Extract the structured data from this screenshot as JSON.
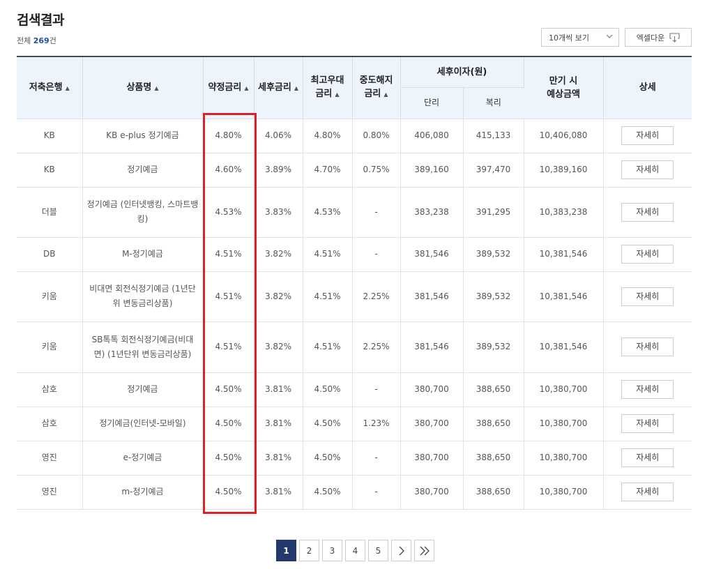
{
  "header": {
    "title": "검색결과",
    "total_prefix": "전체",
    "total_count": "269",
    "total_suffix": "건"
  },
  "toolbar": {
    "per_page_label": "10개씩 보기",
    "excel_label": "엑셀다운"
  },
  "table": {
    "headers": {
      "bank": "저축은행",
      "product": "상품명",
      "rate": "약정금리",
      "after_tax_rate": "세후금리",
      "max_rate_line1": "최고우대",
      "max_rate_line2": "금리",
      "early_rate_line1": "중도해지",
      "early_rate_line2": "금리",
      "interest_group": "세후이자(원)",
      "simple": "단리",
      "compound": "복리",
      "maturity_line1": "만기 시",
      "maturity_line2": "예상금액",
      "detail": "상세"
    },
    "sort_icon": "▲",
    "detail_label": "자세히",
    "rows": [
      {
        "bank": "KB",
        "product": "KB e-plus 정기예금",
        "rate": "4.80%",
        "after_tax": "4.06%",
        "max": "4.80%",
        "early": "0.80%",
        "simple": "406,080",
        "compound": "415,133",
        "maturity": "10,406,080"
      },
      {
        "bank": "KB",
        "product": "정기예금",
        "rate": "4.60%",
        "after_tax": "3.89%",
        "max": "4.70%",
        "early": "0.75%",
        "simple": "389,160",
        "compound": "397,470",
        "maturity": "10,389,160"
      },
      {
        "bank": "더블",
        "product": "정기예금 (인터넷뱅킹, 스마트뱅킹)",
        "rate": "4.53%",
        "after_tax": "3.83%",
        "max": "4.53%",
        "early": "-",
        "simple": "383,238",
        "compound": "391,295",
        "maturity": "10,383,238"
      },
      {
        "bank": "DB",
        "product": "M-정기예금",
        "rate": "4.51%",
        "after_tax": "3.82%",
        "max": "4.51%",
        "early": "-",
        "simple": "381,546",
        "compound": "389,532",
        "maturity": "10,381,546"
      },
      {
        "bank": "키움",
        "product": "비대면 회전식정기예금 (1년단위 변동금리상품)",
        "rate": "4.51%",
        "after_tax": "3.82%",
        "max": "4.51%",
        "early": "2.25%",
        "simple": "381,546",
        "compound": "389,532",
        "maturity": "10,381,546"
      },
      {
        "bank": "키움",
        "product": "SB톡톡 회전식정기예금(비대면) (1년단위 변동금리상품)",
        "rate": "4.51%",
        "after_tax": "3.82%",
        "max": "4.51%",
        "early": "2.25%",
        "simple": "381,546",
        "compound": "389,532",
        "maturity": "10,381,546"
      },
      {
        "bank": "삼호",
        "product": "정기예금",
        "rate": "4.50%",
        "after_tax": "3.81%",
        "max": "4.50%",
        "early": "-",
        "simple": "380,700",
        "compound": "388,650",
        "maturity": "10,380,700"
      },
      {
        "bank": "삼호",
        "product": "정기예금(인터넷-모바일)",
        "rate": "4.50%",
        "after_tax": "3.81%",
        "max": "4.50%",
        "early": "1.23%",
        "simple": "380,700",
        "compound": "388,650",
        "maturity": "10,380,700"
      },
      {
        "bank": "영진",
        "product": "e-정기예금",
        "rate": "4.50%",
        "after_tax": "3.81%",
        "max": "4.50%",
        "early": "-",
        "simple": "380,700",
        "compound": "388,650",
        "maturity": "10,380,700"
      },
      {
        "bank": "영진",
        "product": "m-정기예금",
        "rate": "4.50%",
        "after_tax": "3.81%",
        "max": "4.50%",
        "early": "-",
        "simple": "380,700",
        "compound": "388,650",
        "maturity": "10,380,700"
      }
    ]
  },
  "pagination": {
    "pages": [
      "1",
      "2",
      "3",
      "4",
      "5"
    ],
    "active": "1",
    "next_icon": "chevron-right-icon",
    "last_icon": "double-chevron-right-icon"
  },
  "colors": {
    "highlight": "#e01f26",
    "active_page": "#24396b",
    "header_bg": "#eef4fb",
    "count_text": "#1f4e9c"
  }
}
